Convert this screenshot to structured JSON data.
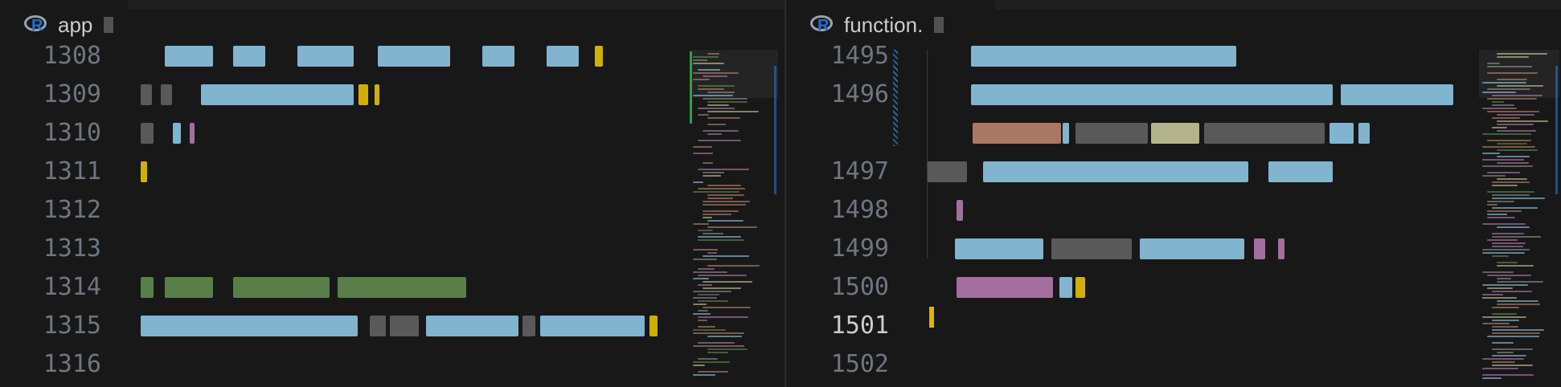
{
  "left_pane": {
    "tab_label": "app",
    "tab_icon": "r-language-icon",
    "line_numbers": [
      "1308",
      "1309",
      "1310",
      "1311",
      "1312",
      "1313",
      "1314",
      "1315",
      "1316"
    ]
  },
  "right_pane": {
    "tab_label": "function.",
    "tab_icon": "r-language-icon",
    "line_numbers": [
      "1495",
      "1496",
      "",
      "1497",
      "1498",
      "1499",
      "1500",
      "1501",
      "1502"
    ]
  },
  "colors": {
    "background": "#181818",
    "line_number": "#6e7681",
    "identifier": "#9cdcfe",
    "function": "#dcdcaa",
    "keyword": "#c586c0",
    "string": "#ce9178",
    "comment": "#6a9955",
    "bracket": "#ffd700",
    "operator": "#d4d4d4"
  }
}
